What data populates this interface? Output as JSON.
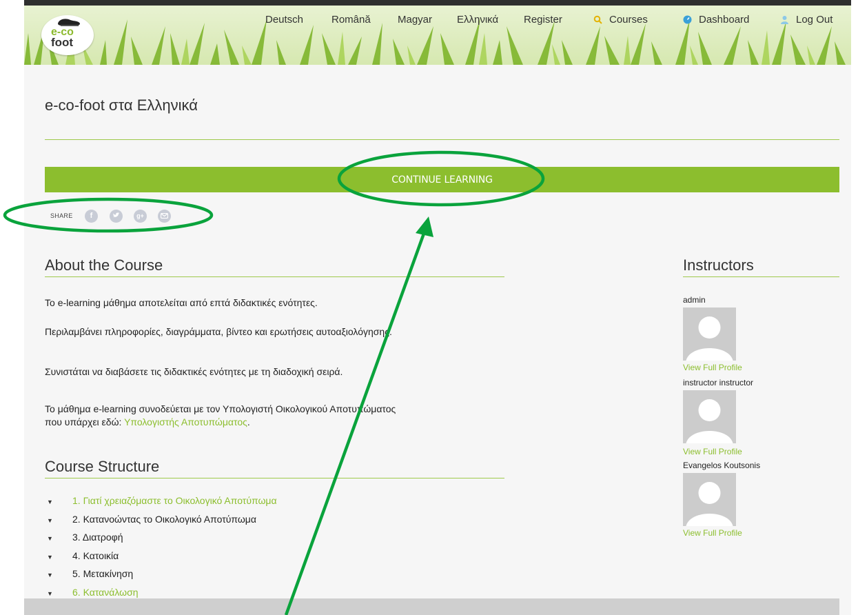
{
  "nav": {
    "items": [
      {
        "label": "Deutsch",
        "icon": ""
      },
      {
        "label": "Română",
        "icon": ""
      },
      {
        "label": "Magyar",
        "icon": ""
      },
      {
        "label": "Ελληνικά",
        "icon": ""
      },
      {
        "label": "Register",
        "icon": ""
      },
      {
        "label": "Courses",
        "icon": "search-icon"
      },
      {
        "label": "Dashboard",
        "icon": "dashboard-icon"
      },
      {
        "label": "Log Out",
        "icon": "user-icon"
      }
    ]
  },
  "logo": {
    "line1": "e-co",
    "line2": "foot"
  },
  "page_title": "e-co-foot στα Ελληνικά",
  "cta_label": "CONTINUE LEARNING",
  "share": {
    "label": "SHARE",
    "icons": [
      "facebook-icon",
      "twitter-icon",
      "google-plus-icon",
      "email-icon"
    ]
  },
  "about": {
    "heading": "About the Course",
    "paragraphs": [
      "Το e-learning μάθημα αποτελείται από επτά διδακτικές ενότητες.",
      "Περιλαμβάνει πληροφορίες, διαγράμματα, βίντεο και ερωτήσεις αυτοαξιολόγησης.",
      "Συνιστάται να διαβάσετε τις διδακτικές ενότητες με τη διαδοχική σειρά.",
      "Το μάθημα e-learning συνοδεύεται με τον Υπολογιστή Οικολογικού Αποτυπώματος"
    ],
    "last_line_prefix": "που υπάρχει εδώ: ",
    "last_line_link": "Υπολογιστής Αποτυπώματος",
    "last_line_suffix": "."
  },
  "structure": {
    "heading": "Course Structure",
    "items": [
      "1. Γιατί χρειαζόμαστε το Οικολογικό Αποτύπωμα",
      "2. Κατανοώντας το Οικολογικό Αποτύπωμα",
      "3. Διατροφή",
      "4. Κατοικία",
      "5. Μετακίνηση",
      "6. Κατανάλωση"
    ]
  },
  "instructors": {
    "heading": "Instructors",
    "list": [
      {
        "name": "admin",
        "link": "View Full Profile"
      },
      {
        "name": "instructor instructor",
        "link": "View Full Profile"
      },
      {
        "name": "Evangelos Koutsonis",
        "link": "View Full Profile"
      }
    ]
  },
  "colors": {
    "accent": "#8cbe2e",
    "annotation": "#0aa33c",
    "topbar": "#2f2f2f"
  }
}
